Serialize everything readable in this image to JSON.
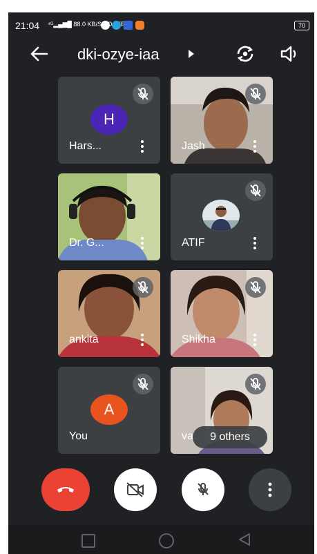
{
  "status_bar": {
    "time": "21:04",
    "signal_text": "⁴ᴳ▂▄▆█ 88.0 KB/S VO LTE",
    "battery": "70"
  },
  "top_bar": {
    "meeting_code": "dki-ozye-iaa",
    "back_icon": "arrow-left-icon",
    "info_icon": "caret-right-icon",
    "switch_camera_icon": "camera-switch-icon",
    "audio_icon": "speaker-icon"
  },
  "participants": [
    {
      "name": "Hars...",
      "avatar_letter": "H",
      "avatar_color": "#4a25b6",
      "muted": true,
      "video": false
    },
    {
      "name": "Jash",
      "muted": true,
      "video": true
    },
    {
      "name": "Dr. G...",
      "muted": false,
      "video": true
    },
    {
      "name": "ATIF",
      "muted": true,
      "video": false,
      "avatar_photo": true
    },
    {
      "name": "ankita",
      "muted": true,
      "video": true
    },
    {
      "name": "Shikha",
      "muted": true,
      "video": true
    },
    {
      "name": "You",
      "avatar_letter": "A",
      "avatar_color": "#e8531e",
      "muted": true,
      "video": false
    },
    {
      "name": "vai...",
      "muted": true,
      "video": true
    }
  ],
  "others_pill": "9 others",
  "controls": {
    "end_call_color": "#ea4335",
    "end_call_icon": "phone-hangup-icon",
    "camera_icon": "video-off-icon",
    "mic_icon": "mic-off-icon",
    "more_icon": "more-vertical-icon"
  },
  "nav": {
    "recents_icon": "square-icon",
    "home_icon": "circle-icon",
    "back_icon": "triangle-back-icon"
  }
}
